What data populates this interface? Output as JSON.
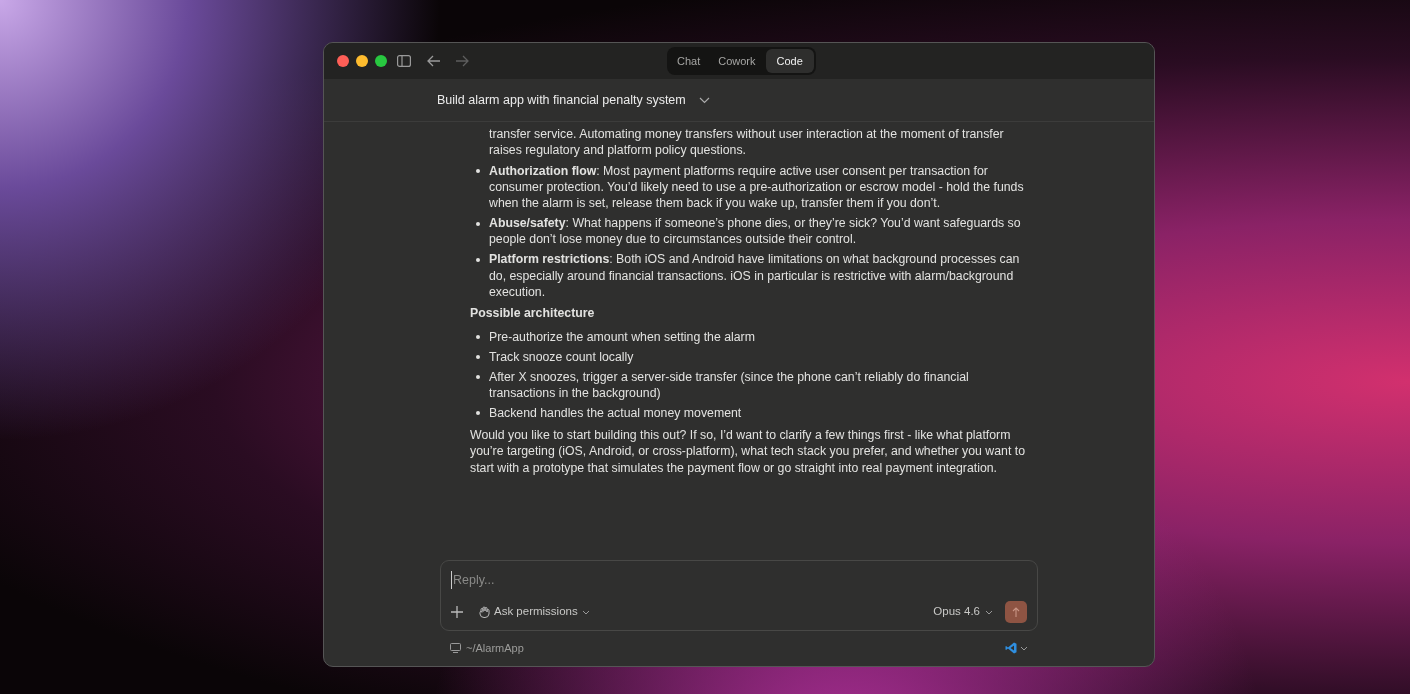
{
  "window": {
    "tabs": [
      {
        "label": "Chat",
        "selected": false
      },
      {
        "label": "Cowork",
        "selected": false
      },
      {
        "label": "Code",
        "selected": true
      }
    ]
  },
  "conversation": {
    "title": "Build alarm app with financial penalty system"
  },
  "message": [
    {
      "kind": "continuation",
      "text": "transfer service. Automating money transfers without user interaction at the moment of transfer raises regulatory and platform policy questions."
    },
    {
      "kind": "bullet",
      "text": "**Authorization flow**: Most payment platforms require active user consent per transaction for consumer protection. You’d likely need to use a pre-authorization or escrow model - hold the funds when the alarm is set, release them back if you wake up, transfer them if you don’t."
    },
    {
      "kind": "bullet",
      "text": "**Abuse/safety**: What happens if someone’s phone dies, or they’re sick? You’d want safeguards so people don’t lose money due to circumstances outside their control."
    },
    {
      "kind": "bullet",
      "text": "**Platform restrictions**: Both iOS and Android have limitations on what background processes can do, especially around financial transactions. iOS in particular is restrictive with alarm/background execution."
    },
    {
      "kind": "heading",
      "text": "Possible architecture"
    },
    {
      "kind": "bullet",
      "text": "Pre-authorize the amount when setting the alarm"
    },
    {
      "kind": "bullet",
      "text": "Track snooze count locally"
    },
    {
      "kind": "bullet",
      "text": "After X snoozes, trigger a server-side transfer (since the phone can’t reliably do financial transactions in the background)"
    },
    {
      "kind": "bullet",
      "text": "Backend handles the actual money movement"
    },
    {
      "kind": "paragraph",
      "text": "Would you like to start building this out? If so, I’d want to clarify a few things first - like what platform you’re targeting (iOS, Android, or cross-platform), what tech stack you prefer, and whether you want to start with a prototype that simulates the payment flow or go straight into real payment integration."
    }
  ],
  "composer": {
    "placeholder": "Reply...",
    "permission_mode": "Ask permissions",
    "model": "Opus 4.6"
  },
  "footer": {
    "path": "~/AlarmApp"
  }
}
